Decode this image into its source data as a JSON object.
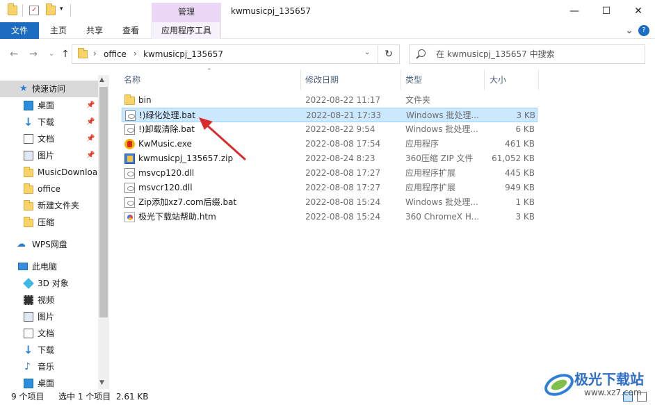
{
  "window": {
    "title": "kwmusicpj_135657",
    "context_tab": "管理",
    "minimize_glyph": "—",
    "maximize_glyph": "☐",
    "close_glyph": "✕"
  },
  "ribbon": {
    "tabs": [
      "文件",
      "主页",
      "共享",
      "查看",
      "应用程序工具"
    ],
    "collapse_glyph": "⌄",
    "help_glyph": "?"
  },
  "address": {
    "path": [
      "office",
      "kwmusicpj_135657"
    ],
    "sep": "›",
    "search_placeholder": "在 kwmusicpj_135657 中搜索"
  },
  "nav_pane": {
    "quick_access": "快速访问",
    "pinned": [
      {
        "label": "桌面",
        "icon": "desktop-icon"
      },
      {
        "label": "下载",
        "icon": "download-icon"
      },
      {
        "label": "文档",
        "icon": "document-icon"
      },
      {
        "label": "图片",
        "icon": "picture-icon"
      }
    ],
    "folders": [
      "MusicDownloa",
      "office",
      "新建文件夹",
      "压缩"
    ],
    "wps": "WPS网盘",
    "this_pc": "此电脑",
    "pc_items": [
      "3D 对象",
      "视频",
      "图片",
      "文档",
      "下载",
      "音乐",
      "桌面"
    ]
  },
  "columns": {
    "name": "名称",
    "date": "修改日期",
    "type": "类型",
    "size": "大小"
  },
  "files": [
    {
      "name": "bin",
      "date": "2022-08-22 11:17",
      "type": "文件夹",
      "size": "",
      "icon": "folder-icon"
    },
    {
      "name": "!)绿化处理.bat",
      "date": "2022-08-21 17:33",
      "type": "Windows 批处理...",
      "size": "3 KB",
      "icon": "batch-file-icon",
      "selected": true
    },
    {
      "name": "!)卸载清除.bat",
      "date": "2022-08-22 9:54",
      "type": "Windows 批处理...",
      "size": "6 KB",
      "icon": "batch-file-icon"
    },
    {
      "name": "KwMusic.exe",
      "date": "2022-08-08 17:54",
      "type": "应用程序",
      "size": "461 KB",
      "icon": "kwmusic-app-icon"
    },
    {
      "name": "kwmusicpj_135657.zip",
      "date": "2022-08-24 8:23",
      "type": "360压缩 ZIP 文件",
      "size": "61,052 KB",
      "icon": "zip-archive-icon"
    },
    {
      "name": "msvcp120.dll",
      "date": "2022-08-08 17:27",
      "type": "应用程序扩展",
      "size": "445 KB",
      "icon": "dll-file-icon"
    },
    {
      "name": "msvcr120.dll",
      "date": "2022-08-08 17:27",
      "type": "应用程序扩展",
      "size": "949 KB",
      "icon": "dll-file-icon"
    },
    {
      "name": "Zip添加xz7.com后缀.bat",
      "date": "2022-08-08 15:24",
      "type": "Windows 批处理...",
      "size": "1 KB",
      "icon": "batch-file-icon"
    },
    {
      "name": "极光下载站帮助.htm",
      "date": "2022-08-08 15:24",
      "type": "360 ChromeX H...",
      "size": "3 KB",
      "icon": "html-file-icon"
    }
  ],
  "status": {
    "count": "9 个项目",
    "selection": "选中 1 个项目  2.61 KB"
  },
  "watermark": {
    "text": "极光下载站",
    "url": "www.xz7.com"
  },
  "colors": {
    "accent": "#1c6dc2",
    "selection_bg": "#cce8ff",
    "manage_tab": "#ead8f6",
    "annotation_arrow": "#d92b2b"
  }
}
